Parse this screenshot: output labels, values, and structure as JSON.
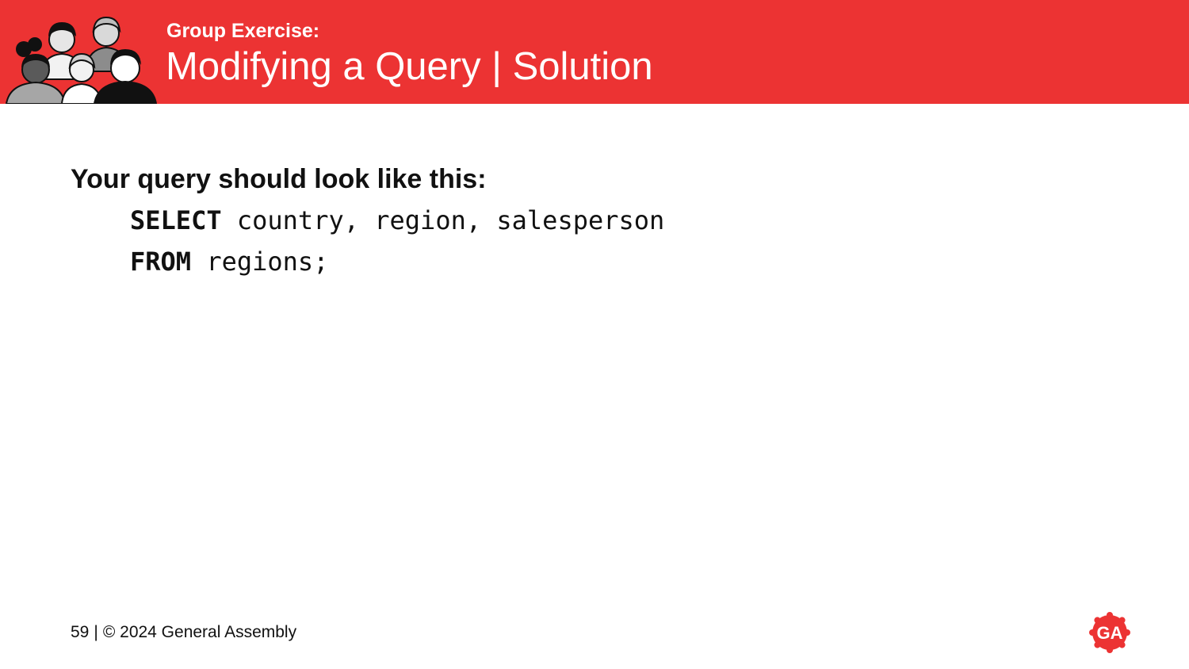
{
  "header": {
    "kicker": "Group Exercise:",
    "title": "Modifying a Query | Solution",
    "illustration_icon": "people-group-icon",
    "background_color": "#ec3333"
  },
  "body": {
    "intro": "Your query should look like this:",
    "code": [
      {
        "keyword": "SELECT",
        "rest": " country, region, salesperson"
      },
      {
        "keyword": "FROM",
        "rest": " regions;"
      }
    ]
  },
  "footer": {
    "page_number": "59",
    "separator": "|",
    "copyright": "© 2024 General Assembly"
  },
  "logo": {
    "text": "GA",
    "icon": "general-assembly-logo-icon",
    "color": "#ec3333"
  }
}
